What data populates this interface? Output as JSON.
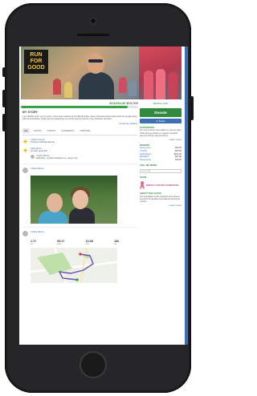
{
  "campaign": {
    "logo_text": "RUN FOR GOOD",
    "raised": "$13,654.20",
    "goal": "$15,000",
    "progress_fraction": 0.91,
    "label_story": "MY STORY",
    "story_text": "I am Charles and I run for good. I have been training for the Big Red Run. Every kilometre helps raise funds for people living with chronic illness. Thank you for supporting me on this journey and for every donation received.",
    "read_more": "Continue reading",
    "tabs": [
      "ALL",
      "POSTS",
      "STATUS",
      "COMMENTS",
      "UPDATES"
    ],
    "active_tab": "ALL"
  },
  "posts": [
    {
      "author": "Charles Carson",
      "text": "Thanks to Michael Renner"
    },
    {
      "author": "Kathy Byrne",
      "text": "Go well, great job!"
    },
    {
      "author": "Charlie Mance",
      "text": "Well done - another fantastic run - keep it up!"
    }
  ],
  "photo_post": {
    "author": "Charlie Mance"
  },
  "activity": {
    "author": "Charlie Mance",
    "stats": [
      {
        "value": "1.71",
        "label": "km"
      },
      {
        "value": "09:27",
        "label": "pace"
      },
      {
        "value": "16:08",
        "label": "time"
      },
      {
        "value": "183",
        "label": "cal"
      }
    ]
  },
  "sidebar": {
    "small_label": "SEARCH LINK",
    "donate": "Donate",
    "share": "Share",
    "support_head": "SUPPORTING",
    "support_text": "For every person who walks or runs we raise funds that go directly to support research and community care programs.",
    "support_link": "Learn more",
    "donors_head": "DONORS",
    "donors": [
      {
        "name": "Anonymous",
        "amount": "$50.00"
      },
      {
        "name": "J Smith",
        "amount": "$25.00"
      },
      {
        "name": "Kathy Byrne",
        "amount": "$100.00"
      },
      {
        "name": "Michael R",
        "amount": "$20.00"
      },
      {
        "name": "Anonymous",
        "amount": "$40.00"
      }
    ],
    "tell_head": "TELL ME WHEN",
    "tell_placeholder": "Your email",
    "team_head": "TEAM",
    "ribbon_text": "BREAST CANCER FOUNDATION",
    "foot_head": "ABOUT THE CAUSE",
    "foot_text": "Our foundation funds research and support services for families and patients across the country.",
    "foot_link": "Learn more"
  },
  "colors": {
    "accent_green": "#2f8a3e",
    "accent_blue": "#3b6fb6",
    "ribbon_pink": "#e06b9a"
  }
}
